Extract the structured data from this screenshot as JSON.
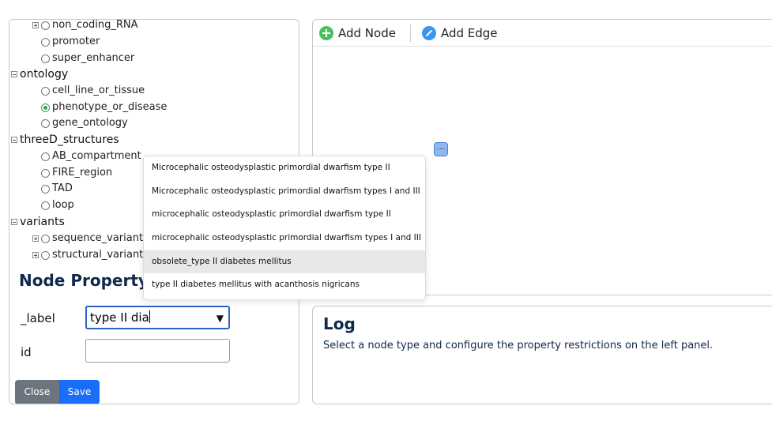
{
  "tree": {
    "rows": [
      {
        "label": "non_coding_RNA",
        "kind": "child-expand",
        "checked": false
      },
      {
        "label": "promoter",
        "kind": "child",
        "checked": false
      },
      {
        "label": "super_enhancer",
        "kind": "child",
        "checked": false
      },
      {
        "label": "ontology",
        "kind": "category"
      },
      {
        "label": "cell_line_or_tissue",
        "kind": "child",
        "checked": false
      },
      {
        "label": "phenotype_or_disease",
        "kind": "child",
        "checked": true
      },
      {
        "label": "gene_ontology",
        "kind": "child",
        "checked": false
      },
      {
        "label": "threeD_structures",
        "kind": "category"
      },
      {
        "label": "AB_compartment",
        "kind": "child",
        "checked": false
      },
      {
        "label": "FIRE_region",
        "kind": "child",
        "checked": false
      },
      {
        "label": "TAD",
        "kind": "child",
        "checked": false
      },
      {
        "label": "loop",
        "kind": "child",
        "checked": false
      },
      {
        "label": "variants",
        "kind": "category"
      },
      {
        "label": "sequence_variant",
        "kind": "child-expand",
        "checked": false
      },
      {
        "label": "structural_variant",
        "kind": "child-expand",
        "checked": false
      }
    ]
  },
  "node_property": {
    "title": "Node Property",
    "label_field": {
      "label": "_label",
      "value": "type II dia"
    },
    "id_field": {
      "label": "id",
      "value": ""
    },
    "close_label": "Close",
    "save_label": "Save"
  },
  "graph": {
    "add_node_label": "Add Node",
    "add_edge_label": "Add Edge",
    "node_text": "..."
  },
  "log": {
    "title": "Log",
    "message": "Select a node type and configure the property restrictions on the left panel."
  },
  "dropdown": {
    "items": [
      "Microcephalic osteodysplastic primordial dwarfism type II",
      "Microcephalic osteodysplastic primordial dwarfism types I and III",
      "microcephalic osteodysplastic primordial dwarfism type II",
      "microcephalic osteodysplastic primordial dwarfism types I and III",
      "obsolete_type II diabetes mellitus",
      "type II diabetes mellitus with acanthosis nigricans"
    ],
    "highlighted_index": 4
  },
  "colors": {
    "primary": "#1a6ef5",
    "secondary": "#6c757d",
    "heading": "#10284a",
    "add_icon": "#4cbf5f",
    "edge_icon": "#3e95f0"
  }
}
